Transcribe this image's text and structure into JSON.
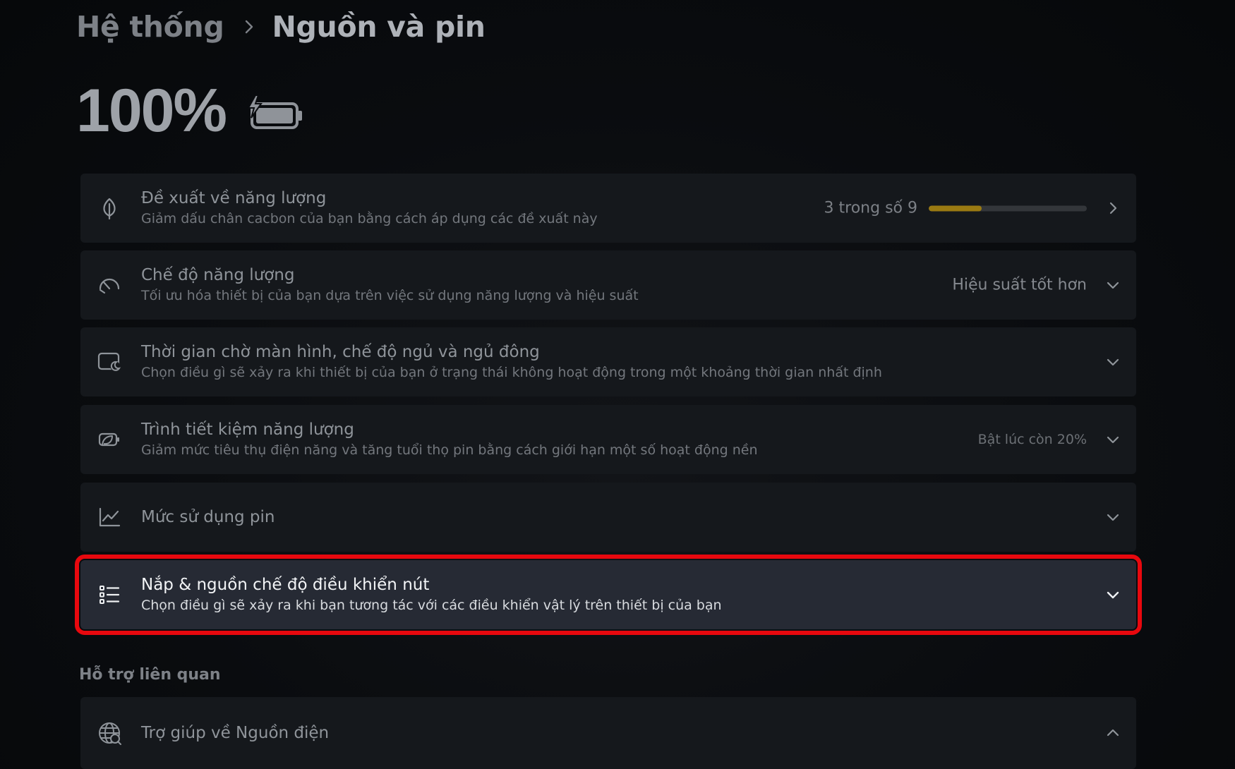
{
  "breadcrumb": {
    "parent": "Hệ thống",
    "current": "Nguồn và pin"
  },
  "battery": {
    "percent": "100%",
    "charging": true
  },
  "settings": [
    {
      "id": "energy-recommendations",
      "icon": "leaf-icon",
      "title": "Đề xuất về năng lượng",
      "subtitle": "Giảm dấu chân cacbon của bạn bằng cách áp dụng các đề xuất này",
      "progress_label": "3 trong số 9",
      "progress_fraction": 0.333,
      "progress_color": "#9a7a12",
      "control": "chevron-right-icon"
    },
    {
      "id": "power-mode",
      "icon": "gauge-icon",
      "title": "Chế độ năng lượng",
      "subtitle": "Tối ưu hóa thiết bị của bạn dựa trên việc sử dụng năng lượng và hiệu suất",
      "value": "Hiệu suất tốt hơn",
      "control": "chevron-down-icon"
    },
    {
      "id": "screen-sleep",
      "icon": "screen-moon-icon",
      "title": "Thời gian chờ màn hình, chế độ ngủ và ngủ đông",
      "subtitle": "Chọn điều gì sẽ xảy ra khi thiết bị của bạn ở trạng thái không hoạt động trong một khoảng thời gian nhất định",
      "control": "chevron-down-icon"
    },
    {
      "id": "energy-saver",
      "icon": "battery-saver-icon",
      "title": "Trình tiết kiệm năng lượng",
      "subtitle": "Giảm mức tiêu thụ điện năng và tăng tuổi thọ pin bằng cách giới hạn một số hoạt động nền",
      "value": "Bật lúc còn 20%",
      "control": "chevron-down-icon"
    },
    {
      "id": "battery-usage",
      "icon": "line-chart-icon",
      "title": "Mức sử dụng pin",
      "control": "chevron-down-icon"
    },
    {
      "id": "lid-power-buttons",
      "icon": "list-icon",
      "title": "Nắp & nguồn chế độ điều khiển nút",
      "subtitle": "Chọn điều gì sẽ xảy ra khi bạn tương tác với các điều khiển vật lý trên thiết bị của bạn",
      "control": "chevron-down-icon",
      "highlighted": true,
      "highlight_color": "#e8080e"
    }
  ],
  "related_support": {
    "heading": "Hỗ trợ liên quan",
    "items": [
      {
        "icon": "globe-icon",
        "title": "Trợ giúp về Nguồn điện",
        "control": "chevron-up-icon"
      }
    ]
  }
}
